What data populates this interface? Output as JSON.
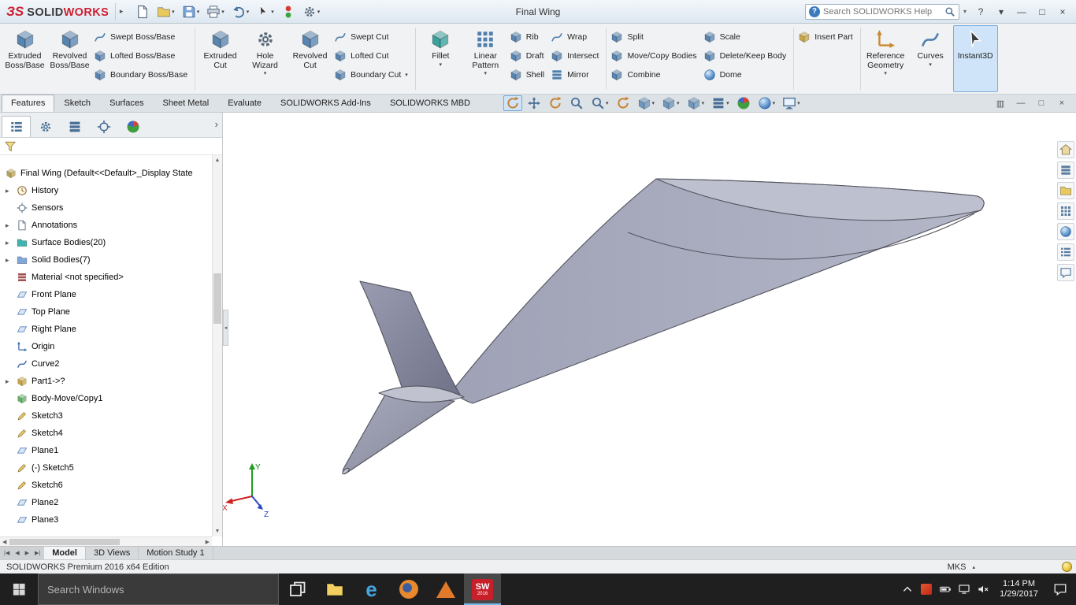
{
  "glyphs": {
    "caret": "▾",
    "expand": "▸",
    "up": "▲",
    "down": "▼",
    "left": "◀",
    "right": "▶",
    "panel_expand": "›",
    "units_caret": "▴",
    "splitter": "◂"
  },
  "title_bar": {
    "logo_mark": "ЗS",
    "logo_solid": "SOLID",
    "logo_works": "WORKS",
    "document_title": "Final Wing",
    "help_badge": "?",
    "help_search_placeholder": "Search SOLIDWORKS Help"
  },
  "quick_toolbar": [
    {
      "name": "new",
      "icon": "page"
    },
    {
      "name": "open",
      "icon": "folder",
      "dropdown": true
    },
    {
      "name": "save",
      "icon": "floppy",
      "dropdown": true
    },
    {
      "name": "print",
      "icon": "printer",
      "dropdown": true
    },
    {
      "name": "undo",
      "icon": "undo",
      "dropdown": true
    },
    {
      "name": "select",
      "icon": "cursor",
      "dropdown": true
    },
    {
      "name": "rebuild",
      "icon": "rebuild"
    },
    {
      "name": "options",
      "icon": "gear",
      "dropdown": true
    }
  ],
  "window_controls": [
    {
      "name": "help",
      "glyph": "?"
    },
    {
      "name": "help-menu",
      "glyph": "▾"
    },
    {
      "name": "minimize",
      "glyph": "—"
    },
    {
      "name": "maximize",
      "glyph": "□"
    },
    {
      "name": "close",
      "glyph": "×"
    }
  ],
  "ribbon": {
    "groups": [
      {
        "cols": [
          {
            "type": "large",
            "label": "Extruded Boss/Base",
            "name": "extruded-boss-base"
          },
          {
            "type": "large",
            "label": "Revolved Boss/Base",
            "name": "revolved-boss-base"
          },
          {
            "type": "stack",
            "items": [
              {
                "label": "Swept Boss/Base",
                "name": "swept-boss-base"
              },
              {
                "label": "Lofted Boss/Base",
                "name": "lofted-boss-base"
              },
              {
                "label": "Boundary Boss/Base",
                "name": "boundary-boss-base"
              }
            ]
          }
        ]
      },
      {
        "cols": [
          {
            "type": "large",
            "label": "Extruded Cut",
            "name": "extruded-cut"
          },
          {
            "type": "large",
            "label": "Hole Wizard",
            "name": "hole-wizard",
            "dropdown": true
          },
          {
            "type": "large",
            "label": "Revolved Cut",
            "name": "revolved-cut"
          },
          {
            "type": "stack",
            "items": [
              {
                "label": "Swept Cut",
                "name": "swept-cut"
              },
              {
                "label": "Lofted Cut",
                "name": "lofted-cut"
              },
              {
                "label": "Boundary Cut",
                "name": "boundary-cut",
                "dropdown": true
              }
            ]
          }
        ]
      },
      {
        "cols": [
          {
            "type": "large",
            "label": "Fillet",
            "name": "fillet",
            "dropdown": true
          },
          {
            "type": "large",
            "label": "Linear Pattern",
            "name": "linear-pattern",
            "dropdown": true
          },
          {
            "type": "stack",
            "items": [
              {
                "label": "Rib",
                "name": "rib"
              },
              {
                "label": "Draft",
                "name": "draft"
              },
              {
                "label": "Shell",
                "name": "shell"
              }
            ]
          },
          {
            "type": "stack",
            "items": [
              {
                "label": "Wrap",
                "name": "wrap"
              },
              {
                "label": "Intersect",
                "name": "intersect"
              },
              {
                "label": "Mirror",
                "name": "mirror"
              }
            ]
          }
        ]
      },
      {
        "cols": [
          {
            "type": "stack",
            "items": [
              {
                "label": "Split",
                "name": "split"
              },
              {
                "label": "Move/Copy Bodies",
                "name": "move-copy-bodies"
              },
              {
                "label": "Combine",
                "name": "combine"
              }
            ]
          },
          {
            "type": "stack",
            "items": [
              {
                "label": "Scale",
                "name": "scale"
              },
              {
                "label": "Delete/Keep Body",
                "name": "delete-keep-body"
              },
              {
                "label": "Dome",
                "name": "dome"
              }
            ]
          }
        ]
      },
      {
        "cols": [
          {
            "type": "stack",
            "items": [
              {
                "label": "Insert Part",
                "name": "insert-part"
              }
            ]
          }
        ]
      },
      {
        "cols": [
          {
            "type": "large",
            "label": "Reference Geometry",
            "name": "reference-geometry",
            "dropdown": true
          },
          {
            "type": "large",
            "label": "Curves",
            "name": "curves",
            "dropdown": true
          },
          {
            "type": "large",
            "label": "Instant3D",
            "name": "instant3d",
            "active": true
          }
        ]
      }
    ]
  },
  "tab_bar": {
    "tabs": [
      {
        "label": "Features",
        "active": true
      },
      {
        "label": "Sketch"
      },
      {
        "label": "Surfaces"
      },
      {
        "label": "Sheet Metal"
      },
      {
        "label": "Evaluate"
      },
      {
        "label": "SOLIDWORKS Add-Ins"
      },
      {
        "label": "SOLIDWORKS MBD"
      }
    ]
  },
  "view_toolbar": {
    "items": [
      {
        "name": "redraw",
        "icon": "circ",
        "active": true
      },
      {
        "name": "pan",
        "icon": "pan"
      },
      {
        "name": "rotate-view",
        "icon": "circ"
      },
      {
        "name": "zoom-to-fit",
        "icon": "mag"
      },
      {
        "name": "zoom-to-area",
        "icon": "mag",
        "dropdown": true
      },
      {
        "name": "previous-view",
        "icon": "circ"
      },
      {
        "name": "section-view",
        "icon": "cube",
        "dropdown": true
      },
      {
        "name": "view-orientation",
        "icon": "cube",
        "dropdown": true
      },
      {
        "name": "display-style",
        "icon": "cube",
        "dropdown": true
      },
      {
        "name": "hide-show-items",
        "icon": "layers",
        "dropdown": true
      },
      {
        "name": "edit-appearance",
        "icon": "ball2"
      },
      {
        "name": "apply-scene",
        "icon": "ball",
        "dropdown": true
      },
      {
        "name": "view-settings",
        "icon": "mon",
        "dropdown": true
      }
    ]
  },
  "document_controls": [
    {
      "name": "dock",
      "glyph": "▥"
    },
    {
      "name": "minimize",
      "glyph": "—"
    },
    {
      "name": "restore",
      "glyph": "□"
    },
    {
      "name": "close",
      "glyph": "×"
    }
  ],
  "panel_tabs": [
    {
      "name": "featuremanager",
      "icon": "list",
      "active": true
    },
    {
      "name": "propertymanager",
      "icon": "gear"
    },
    {
      "name": "configurationmanager",
      "icon": "layers"
    },
    {
      "name": "dimxpertmanager",
      "icon": "target"
    },
    {
      "name": "displaymanager",
      "icon": "ball2"
    }
  ],
  "feature_tree": {
    "root": {
      "label": "Final Wing (Default<<Default>_Display State",
      "name": "final-wing-root",
      "icon": "cube",
      "color": "#b5a04a"
    },
    "items": [
      {
        "label": "History",
        "name": "history",
        "icon": "clock",
        "color": "#8a6d2f",
        "arrow": true
      },
      {
        "label": "Sensors",
        "name": "sensors",
        "icon": "target",
        "color": "#6f7f94",
        "arrow": false
      },
      {
        "label": "Annotations",
        "name": "annotations",
        "icon": "page",
        "color": "#b08c3e",
        "arrow": true
      },
      {
        "label": "Surface Bodies(20)",
        "name": "surface-bodies",
        "icon": "folder",
        "color": "#3fb3ad",
        "arrow": true
      },
      {
        "label": "Solid Bodies(7)",
        "name": "solid-bodies",
        "icon": "folder",
        "color": "#7fa7d9",
        "arrow": true
      },
      {
        "label": "Material <not specified>",
        "name": "material",
        "icon": "layers",
        "color": "#a05050",
        "arrow": false
      },
      {
        "label": "Front Plane",
        "name": "front-plane",
        "icon": "plane",
        "color": "#6b93c9",
        "arrow": false
      },
      {
        "label": "Top Plane",
        "name": "top-plane",
        "icon": "plane",
        "color": "#6b93c9",
        "arrow": false
      },
      {
        "label": "Right Plane",
        "name": "right-plane",
        "icon": "plane",
        "color": "#6b93c9",
        "arrow": false
      },
      {
        "label": "Origin",
        "name": "origin",
        "icon": "axes",
        "color": "#3a66b0",
        "arrow": false
      },
      {
        "label": "Curve2",
        "name": "curve2",
        "icon": "curve",
        "color": "#3a66b0",
        "arrow": false
      },
      {
        "label": "Part1->?",
        "name": "part1",
        "icon": "cube",
        "color": "#c9a23f",
        "arrow": true
      },
      {
        "label": "Body-Move/Copy1",
        "name": "body-move-copy1",
        "icon": "cube",
        "color": "#5fae5f",
        "arrow": false
      },
      {
        "label": "Sketch3",
        "name": "sketch3",
        "icon": "pencil",
        "color": "#7a7f8a",
        "arrow": false
      },
      {
        "label": "Sketch4",
        "name": "sketch4",
        "icon": "pencil",
        "color": "#7a7f8a",
        "arrow": false
      },
      {
        "label": "Plane1",
        "name": "plane1",
        "icon": "plane",
        "color": "#6b93c9",
        "arrow": false
      },
      {
        "label": "(-) Sketch5",
        "name": "sketch5",
        "icon": "pencil",
        "color": "#7a7f8a",
        "arrow": false
      },
      {
        "label": "Sketch6",
        "name": "sketch6",
        "icon": "pencil",
        "color": "#7a7f8a",
        "arrow": false
      },
      {
        "label": "Plane2",
        "name": "plane2",
        "icon": "plane",
        "color": "#6b93c9",
        "arrow": false
      },
      {
        "label": "Plane3",
        "name": "plane3",
        "icon": "plane",
        "color": "#6b93c9",
        "arrow": false
      }
    ]
  },
  "task_pane": {
    "items": [
      {
        "name": "solidworks-resources",
        "icon": "house"
      },
      {
        "name": "design-library",
        "icon": "layers"
      },
      {
        "name": "file-explorer",
        "icon": "folder"
      },
      {
        "name": "view-palette",
        "icon": "grid"
      },
      {
        "name": "appearances-scenes",
        "icon": "ball"
      },
      {
        "name": "custom-properties",
        "icon": "list"
      },
      {
        "name": "solidworks-forum",
        "icon": "chat"
      }
    ]
  },
  "triad": {
    "x": "X",
    "y": "Y",
    "z": "Z"
  },
  "document_tabs": {
    "nav": [
      "|◀",
      "◀",
      "▶",
      "▶|"
    ],
    "nav_names": [
      "first",
      "previous",
      "next",
      "last"
    ],
    "tabs": [
      {
        "label": "Model",
        "active": true
      },
      {
        "label": "3D Views"
      },
      {
        "label": "Motion Study 1"
      }
    ]
  },
  "status_bar": {
    "edition": "SOLIDWORKS Premium 2016 x64 Edition",
    "units": "MKS"
  },
  "taskbar": {
    "search_placeholder": "Search Windows",
    "time": "1:14 PM",
    "date": "1/29/2017",
    "apps": [
      {
        "name": "task-view",
        "icon": "taskview"
      },
      {
        "name": "file-explorer",
        "icon": "folder"
      },
      {
        "name": "edge",
        "icon": "edge",
        "glyph": "e"
      },
      {
        "name": "firefox",
        "icon": "firefox"
      },
      {
        "name": "matlab",
        "icon": "matlab"
      },
      {
        "name": "solidworks",
        "icon": "solidworks",
        "text": "SW",
        "year": "2016",
        "active": true
      }
    ],
    "tray": [
      {
        "name": "hidden-icons",
        "icon": "chevup"
      },
      {
        "name": "tray-app",
        "icon": "trayapp"
      },
      {
        "name": "battery",
        "icon": "battery"
      },
      {
        "name": "network",
        "icon": "net"
      },
      {
        "name": "volume-muted",
        "icon": "speakerx"
      }
    ]
  }
}
